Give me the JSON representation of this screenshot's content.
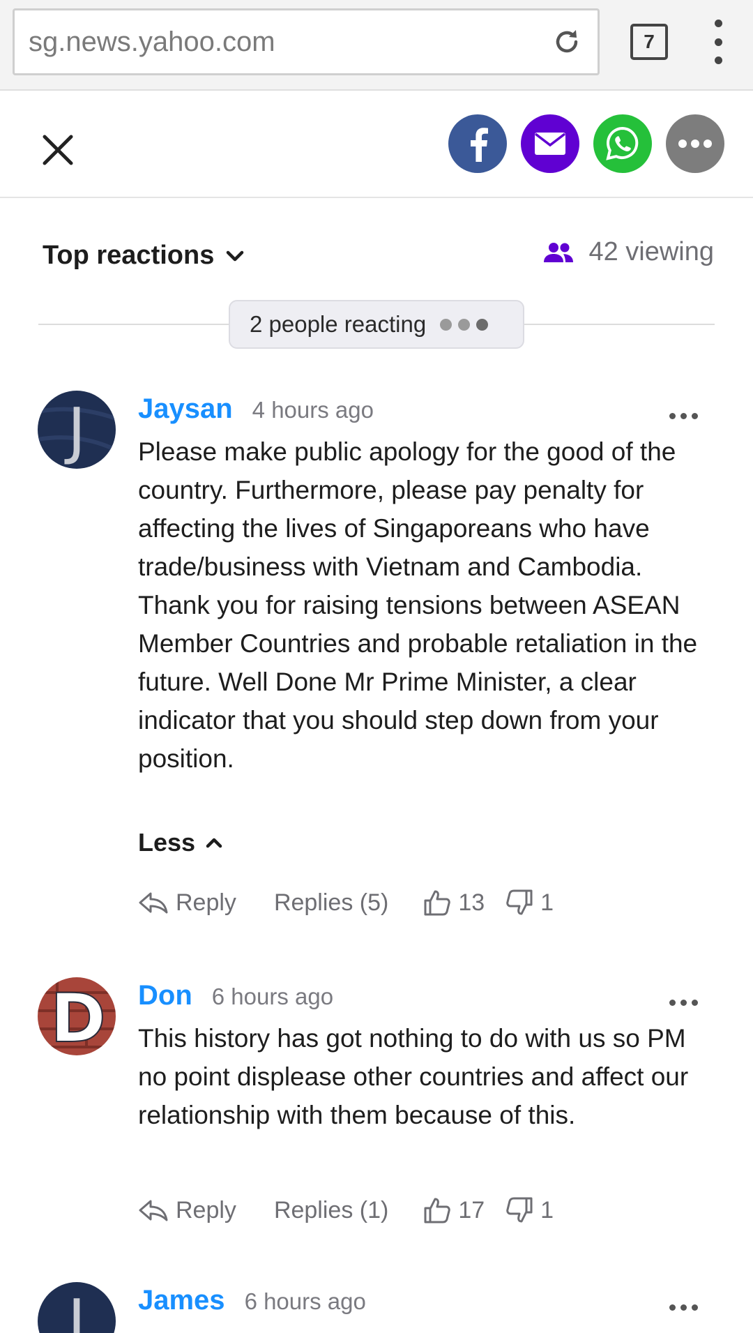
{
  "browser": {
    "url": "sg.news.yahoo.com",
    "tab_count": "7"
  },
  "share": {
    "buttons": [
      {
        "name": "facebook",
        "color": "#3b5998"
      },
      {
        "name": "mail",
        "color": "#6001d2"
      },
      {
        "name": "whatsapp",
        "color": "#25c03a"
      },
      {
        "name": "more",
        "color": "#7d7d7d"
      }
    ]
  },
  "reactions": {
    "sort_label": "Top reactions",
    "viewing_text": "42 viewing",
    "reacting_text": "2 people reacting"
  },
  "comments": [
    {
      "author": "Jaysan",
      "time": "4 hours ago",
      "avatar_letter": "J",
      "text": "Please make public apology for the good of the country. Furthermore, please pay penalty for affecting the lives of Singaporeans who have trade/business with Vietnam and Cambodia. Thank you for raising tensions between ASEAN Member Countries and probable retaliation in the future. Well Done Mr Prime Minister, a clear indicator that you should step down from your position.",
      "less_label": "Less",
      "reply_label": "Reply",
      "replies_label": "Replies (5)",
      "likes": "13",
      "dislikes": "1"
    },
    {
      "author": "Don",
      "time": "6 hours ago",
      "avatar_letter": "D",
      "text": "This history has got nothing to do with us so PM no point displease other countries and affect our relationship with them because of this.",
      "reply_label": "Reply",
      "replies_label": "Replies (1)",
      "likes": "17",
      "dislikes": "1"
    },
    {
      "author": "James",
      "time": "6 hours ago",
      "avatar_letter": "J"
    }
  ],
  "colors": {
    "author_link": "#188fff",
    "viewing_icon": "#6001d2"
  }
}
